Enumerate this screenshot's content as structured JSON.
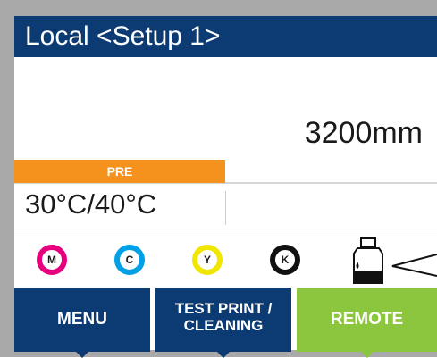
{
  "header": {
    "title": "Local <Setup 1>"
  },
  "main": {
    "media_width": "3200mm"
  },
  "heater": {
    "label": "PRE",
    "temperature": "30°C/40°C"
  },
  "inks": [
    {
      "label": "M",
      "color": "#e6007e"
    },
    {
      "label": "C",
      "color": "#00a0e6"
    },
    {
      "label": "Y",
      "color": "#f1e600"
    },
    {
      "label": "K",
      "color": "#111111"
    }
  ],
  "ink_bottle_icon": "ink-bottle-icon",
  "function_keys": {
    "menu": "MENU",
    "test_print_line1": "TEST PRINT /",
    "test_print_line2": "CLEANING",
    "remote": "REMOTE"
  },
  "colors": {
    "title_bar": "#0c3b74",
    "pre_heater": "#f5921e",
    "remote_button": "#8cc63f"
  }
}
